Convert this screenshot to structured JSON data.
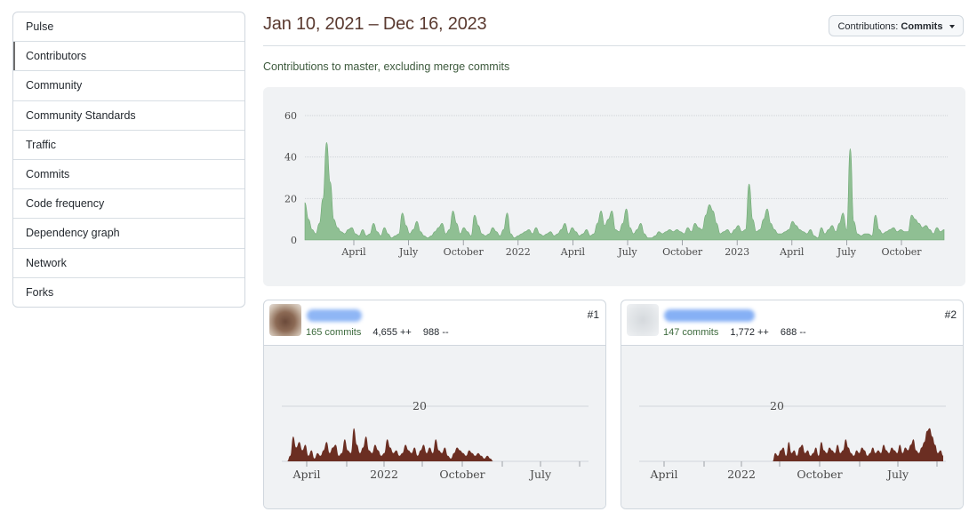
{
  "sidebar": {
    "items": [
      {
        "label": "Pulse"
      },
      {
        "label": "Contributors",
        "active": true
      },
      {
        "label": "Community"
      },
      {
        "label": "Community Standards"
      },
      {
        "label": "Traffic"
      },
      {
        "label": "Commits"
      },
      {
        "label": "Code frequency"
      },
      {
        "label": "Dependency graph"
      },
      {
        "label": "Network"
      },
      {
        "label": "Forks"
      }
    ]
  },
  "header": {
    "date_range": "Jan 10, 2021 – Dec 16, 2023",
    "contributions_prefix": "Contributions:",
    "contributions_value": "Commits",
    "subtitle": "Contributions to master, excluding merge commits"
  },
  "colors": {
    "main_area": "#8fbf93",
    "main_stroke": "#6ea873",
    "contributor_area": "#6b2e22",
    "background_panel": "#f0f2f4"
  },
  "chart_data": [
    {
      "type": "area",
      "title": "",
      "x_type": "weekly dates",
      "x_start": "2021-01-10",
      "x_end": "2023-12-16",
      "x_tick_labels": [
        "April",
        "July",
        "October",
        "2022",
        "April",
        "July",
        "October",
        "2023",
        "April",
        "July",
        "October"
      ],
      "y_ticks": [
        0,
        20,
        40,
        60
      ],
      "ylim": [
        0,
        65
      ],
      "grid": true,
      "series": [
        {
          "values": [
            18,
            10,
            5,
            3,
            8,
            20,
            47,
            28,
            10,
            6,
            4,
            3,
            5,
            6,
            3,
            2,
            5,
            2,
            3,
            8,
            4,
            2,
            6,
            3,
            1,
            2,
            3,
            13,
            7,
            3,
            5,
            9,
            4,
            2,
            1,
            2,
            4,
            6,
            8,
            3,
            5,
            14,
            8,
            3,
            6,
            4,
            2,
            12,
            7,
            3,
            2,
            3,
            6,
            4,
            2,
            5,
            13,
            3,
            1,
            2,
            3,
            4,
            5,
            3,
            6,
            3,
            2,
            3,
            4,
            2,
            3,
            5,
            8,
            3,
            6,
            4,
            2,
            3,
            5,
            2,
            3,
            8,
            14,
            7,
            10,
            14,
            5,
            4,
            8,
            15,
            6,
            3,
            5,
            8,
            3,
            1,
            1,
            2,
            4,
            3,
            4,
            5,
            4,
            5,
            4,
            3,
            6,
            4,
            8,
            6,
            5,
            12,
            17,
            14,
            8,
            3,
            4,
            5,
            3,
            5,
            7,
            4,
            5,
            27,
            10,
            4,
            5,
            10,
            15,
            8,
            5,
            3,
            3,
            4,
            5,
            9,
            7,
            5,
            4,
            3,
            5,
            2,
            1,
            6,
            3,
            5,
            7,
            4,
            8,
            13,
            5,
            44,
            9,
            3,
            2,
            3,
            3,
            2,
            12,
            5,
            3,
            4,
            5,
            6,
            4,
            5,
            4,
            4,
            12,
            10,
            8,
            6,
            7,
            5,
            3,
            6,
            4,
            5
          ]
        }
      ]
    },
    {
      "type": "area",
      "title": "",
      "x_tick_labels": [
        "April",
        "2022",
        "October",
        "July"
      ],
      "y_ticks": [
        20
      ],
      "series": [
        {
          "values": [
            0,
            2,
            9,
            5,
            7,
            4,
            6,
            2,
            4,
            1,
            3,
            2,
            4,
            7,
            3,
            5,
            6,
            2,
            3,
            8,
            4,
            3,
            12,
            6,
            3,
            5,
            9,
            4,
            3,
            6,
            4,
            2,
            3,
            8,
            5,
            3,
            4,
            2,
            3,
            6,
            4,
            3,
            5,
            2,
            4,
            6,
            3,
            5,
            3,
            8,
            4,
            3,
            5,
            2,
            1,
            3,
            5,
            4,
            3,
            2,
            4,
            3,
            2,
            3,
            2,
            1,
            2,
            1,
            0
          ]
        }
      ]
    },
    {
      "type": "area",
      "title": "",
      "x_tick_labels": [
        "April",
        "2022",
        "October",
        "July"
      ],
      "y_ticks": [
        20
      ],
      "series": [
        {
          "values": [
            0,
            3,
            2,
            4,
            5,
            2,
            7,
            3,
            4,
            2,
            5,
            6,
            3,
            4,
            2,
            3,
            5,
            2,
            7,
            4,
            3,
            5,
            4,
            3,
            6,
            3,
            4,
            8,
            5,
            3,
            2,
            4,
            3,
            5,
            4,
            2,
            3,
            5,
            3,
            4,
            3,
            6,
            4,
            3,
            5,
            4,
            3,
            6,
            3,
            5,
            4,
            6,
            8,
            4,
            3,
            5,
            7,
            11,
            12,
            9,
            6,
            3,
            4,
            2
          ]
        }
      ]
    }
  ],
  "contributors": [
    {
      "rank": "#1",
      "commits": "165 commits",
      "additions": "4,655 ++",
      "deletions": "988 --",
      "y_label": "20"
    },
    {
      "rank": "#2",
      "commits": "147 commits",
      "additions": "1,772 ++",
      "deletions": "688 --",
      "y_label": "20"
    }
  ]
}
